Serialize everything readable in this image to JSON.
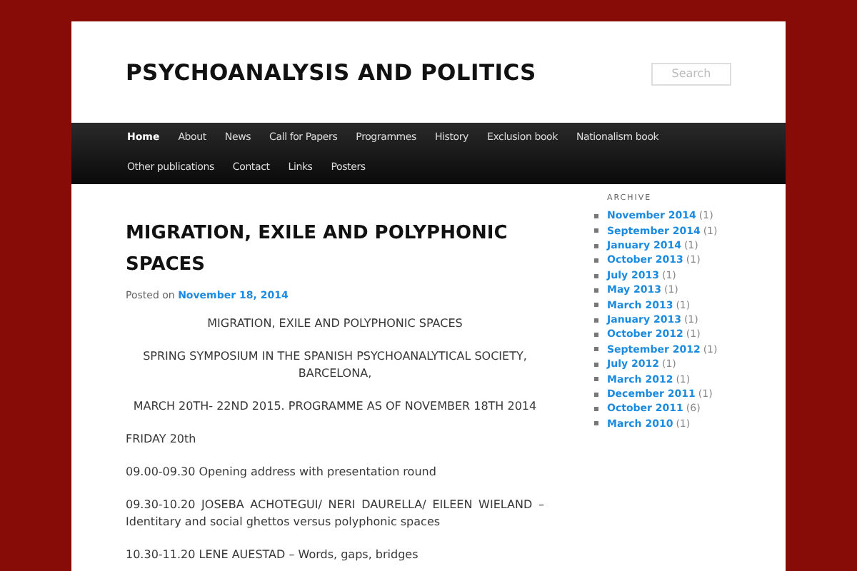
{
  "site": {
    "title": "PSYCHOANALYSIS AND POLITICS",
    "search": {
      "placeholder": "Search"
    }
  },
  "nav": [
    {
      "label": "Home",
      "selected": true
    },
    {
      "label": "About",
      "selected": false
    },
    {
      "label": "News",
      "selected": false
    },
    {
      "label": "Call for Papers",
      "selected": false
    },
    {
      "label": "Programmes",
      "selected": false
    },
    {
      "label": "History",
      "selected": false
    },
    {
      "label": "Exclusion book",
      "selected": false
    },
    {
      "label": "Nationalism book",
      "selected": false
    },
    {
      "label": "Other publications",
      "selected": false
    },
    {
      "label": "Contact",
      "selected": false
    },
    {
      "label": "Links",
      "selected": false
    },
    {
      "label": "Posters",
      "selected": false
    }
  ],
  "post": {
    "title": "MIGRATION, EXILE AND POLYPHONIC SPACES",
    "posted_prefix": "Posted on",
    "date": "November 18, 2014",
    "paragraphs": [
      {
        "kind": "center",
        "text": "MIGRATION, EXILE AND POLYPHONIC SPACES"
      },
      {
        "kind": "center",
        "text": "SPRING SYMPOSIUM IN THE SPANISH PSYCHOANALYTICAL SOCIETY, BARCELONA,"
      },
      {
        "kind": "center",
        "text": "MARCH 20TH- 22ND 2015. PROGRAMME AS OF NOVEMBER 18TH 2014"
      },
      {
        "kind": "left",
        "text": "FRIDAY 20th"
      },
      {
        "kind": "left",
        "text": "09.00-09.30 Opening address with presentation round"
      },
      {
        "kind": "justify",
        "text": "09.30-10.20 JOSEBA ACHOTEGUI/ NERI DAURELLA/ EILEEN WIELAND – Identitary and social ghettos versus polyphonic spaces"
      },
      {
        "kind": "left",
        "text": "10.30-11.20 LENE AUESTAD – Words, gaps, bridges"
      }
    ]
  },
  "archive": {
    "heading": "ARCHIVE",
    "items": [
      {
        "label": "November 2014",
        "count": "(1)"
      },
      {
        "label": "September 2014",
        "count": "(1)"
      },
      {
        "label": "January 2014",
        "count": "(1)"
      },
      {
        "label": "October 2013",
        "count": "(1)"
      },
      {
        "label": "July 2013",
        "count": "(1)"
      },
      {
        "label": "May 2013",
        "count": "(1)"
      },
      {
        "label": "March 2013",
        "count": "(1)"
      },
      {
        "label": "January 2013",
        "count": "(1)"
      },
      {
        "label": "October 2012",
        "count": "(1)"
      },
      {
        "label": "September 2012",
        "count": "(1)"
      },
      {
        "label": "July 2012",
        "count": "(1)"
      },
      {
        "label": "March 2012",
        "count": "(1)"
      },
      {
        "label": "December 2011",
        "count": "(1)"
      },
      {
        "label": "October 2011",
        "count": "(6)"
      },
      {
        "label": "March 2010",
        "count": "(1)"
      }
    ]
  }
}
